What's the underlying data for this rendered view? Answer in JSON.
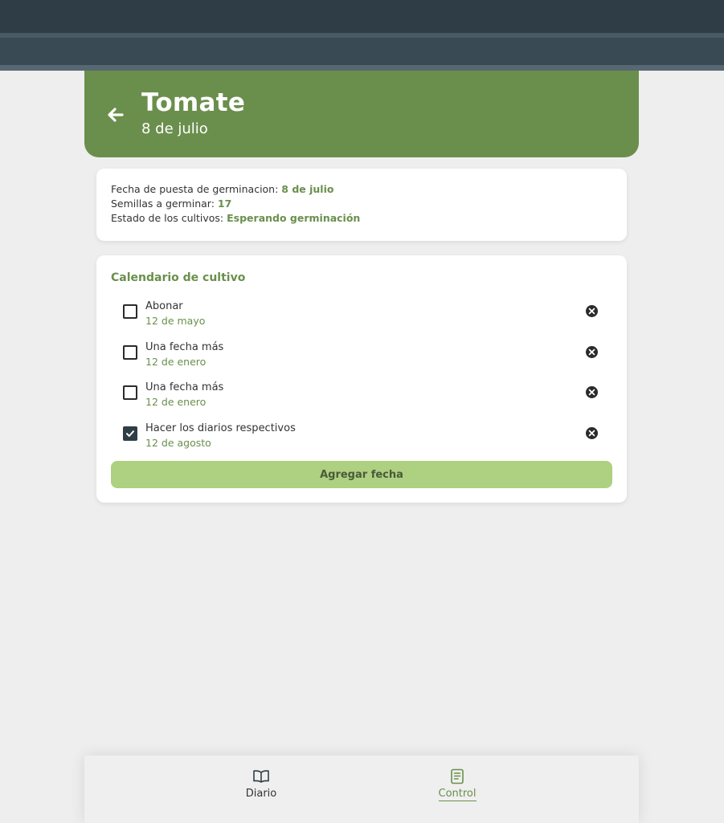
{
  "header": {
    "title": "Tomate",
    "subtitle": "8 de julio",
    "back_icon": "arrow-left-icon"
  },
  "info": {
    "germination_label": "Fecha de puesta de germinacion: ",
    "germination_value": "8 de julio",
    "seeds_label": "Semillas a germinar: ",
    "seeds_value": "17",
    "status_label": "Estado de los cultivos: ",
    "status_value": "Esperando germinación"
  },
  "calendar": {
    "title": "Calendario de cultivo",
    "items": [
      {
        "label": "Abonar",
        "date": "12 de mayo",
        "checked": false
      },
      {
        "label": "Una fecha más",
        "date": "12 de enero",
        "checked": false
      },
      {
        "label": "Una fecha más",
        "date": "12 de enero",
        "checked": false
      },
      {
        "label": "Hacer los diarios respectivos",
        "date": "12 de agosto",
        "checked": true
      }
    ],
    "add_button": "Agregar fecha"
  },
  "nav": {
    "items": [
      {
        "label": "Diario",
        "icon": "book-open-icon",
        "active": false
      },
      {
        "label": "Control",
        "icon": "document-icon",
        "active": true
      }
    ]
  },
  "colors": {
    "accent": "#6a8f4c",
    "button": "#aed081",
    "topbar": "#2f3e46"
  }
}
